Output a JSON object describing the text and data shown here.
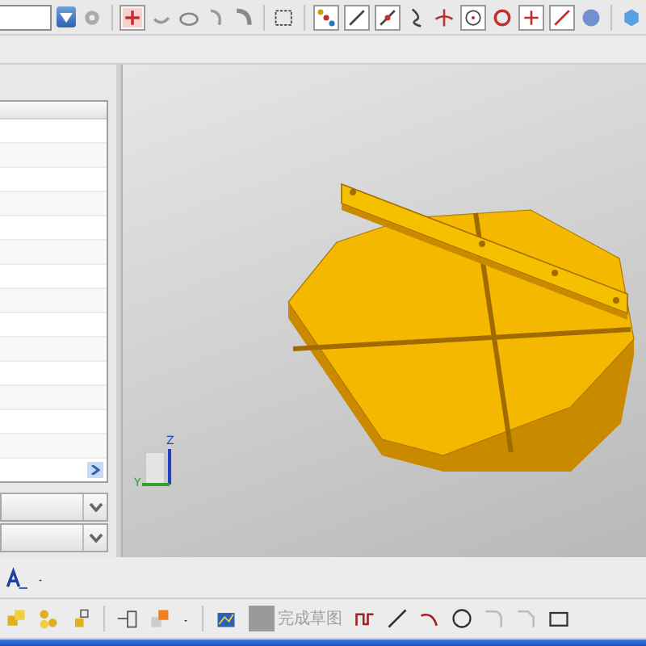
{
  "sketch_toolbar": {
    "finish_sketch": {
      "label": "完成草图",
      "disabled": true
    }
  },
  "view_triad": {
    "z_label": "Z",
    "y_label": "Y"
  }
}
